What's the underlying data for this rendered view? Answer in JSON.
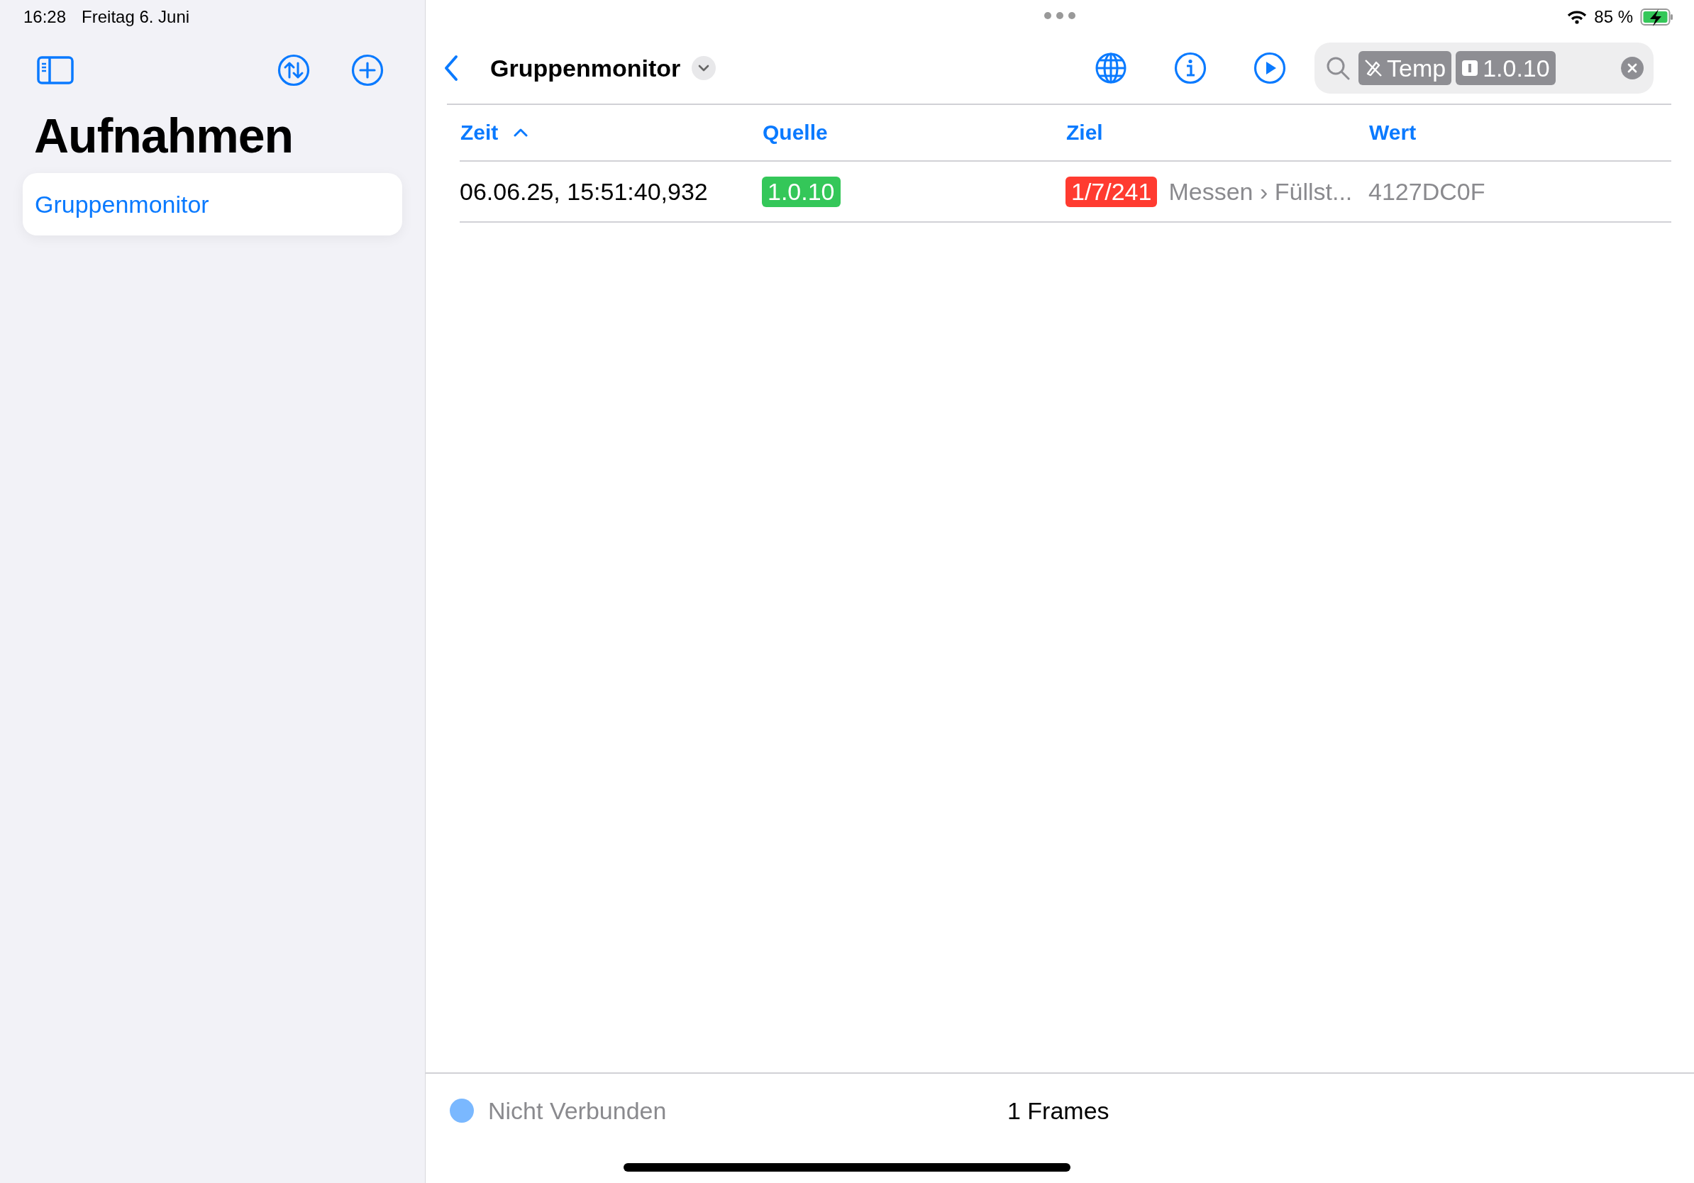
{
  "status_bar": {
    "time": "16:28",
    "date": "Freitag 6. Juni",
    "battery": "85 %",
    "charging": true
  },
  "sidebar": {
    "title": "Aufnahmen",
    "items": [
      {
        "label": "Gruppenmonitor",
        "selected": true
      }
    ]
  },
  "toolbar": {
    "title": "Gruppenmonitor"
  },
  "search": {
    "tokens": [
      {
        "kind": "datapoint",
        "label": "Temp"
      },
      {
        "kind": "address",
        "label": "1.0.10"
      }
    ]
  },
  "table": {
    "columns": [
      {
        "label": "Zeit",
        "sorted": true
      },
      {
        "label": "Quelle",
        "sorted": false
      },
      {
        "label": "Ziel",
        "sorted": false
      },
      {
        "label": "Wert",
        "sorted": false
      }
    ],
    "rows": [
      {
        "time": "06.06.25, 15:51:40,932",
        "source": "1.0.10",
        "target": "1/7/241",
        "target_name": "Messen › Füllst...",
        "value": "4127DC0F"
      }
    ]
  },
  "footer": {
    "status": "Nicht Verbunden",
    "connected": false,
    "frames": "1 Frames"
  }
}
